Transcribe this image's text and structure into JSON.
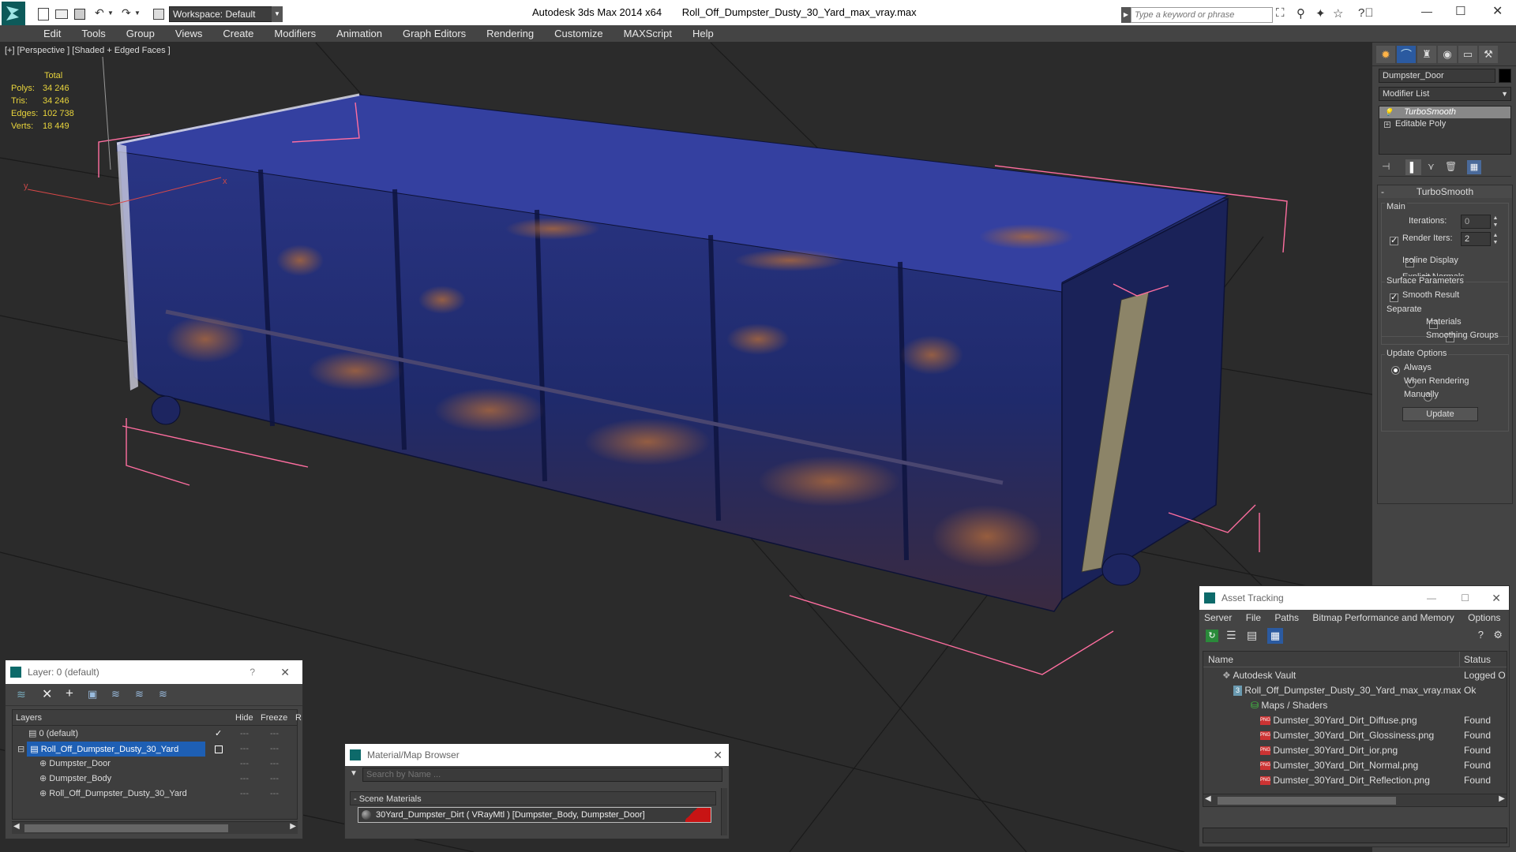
{
  "titlebar": {
    "workspace": "Workspace: Default",
    "app_title": "Autodesk 3ds Max  2014 x64",
    "file_name": "Roll_Off_Dumpster_Dusty_30_Yard_max_vray.max",
    "search_placeholder": "Type a keyword or phrase"
  },
  "menu": [
    "Edit",
    "Tools",
    "Group",
    "Views",
    "Create",
    "Modifiers",
    "Animation",
    "Graph Editors",
    "Rendering",
    "Customize",
    "MAXScript",
    "Help"
  ],
  "viewport": {
    "label": "[+] [Perspective ] [Shaded + Edged Faces ]",
    "stats": {
      "header": "Total",
      "rows": [
        {
          "label": "Polys:",
          "value": "34 246"
        },
        {
          "label": "Tris:",
          "value": "34 246"
        },
        {
          "label": "Edges:",
          "value": "102 738"
        },
        {
          "label": "Verts:",
          "value": "18 449"
        }
      ]
    },
    "axis_y": "y",
    "axis_x": "x"
  },
  "cmdpanel": {
    "object_name": "Dumpster_Door",
    "modifier_list": "Modifier List",
    "stack": [
      "TurboSmooth",
      "Editable Poly"
    ],
    "rollout_title": "TurboSmooth",
    "main_label": "Main",
    "iterations_label": "Iterations:",
    "iterations_value": "0",
    "render_iters_label": "Render Iters:",
    "render_iters_value": "2",
    "isoline": "Isoline Display",
    "explicit": "Explicit Normals",
    "surface_params": "Surface Parameters",
    "smooth_result": "Smooth Result",
    "separate": "Separate",
    "materials": "Materials",
    "smoothing_groups": "Smoothing Groups",
    "update_options": "Update Options",
    "always": "Always",
    "when_rendering": "When Rendering",
    "manually": "Manually",
    "update_button": "Update"
  },
  "layer_window": {
    "title": "Layer: 0 (default)",
    "help": "?",
    "close": "✕",
    "col_layers": "Layers",
    "col_hide": "Hide",
    "col_freeze": "Freeze",
    "col_r": "R",
    "rows": [
      {
        "name": "0 (default)"
      },
      {
        "name": "Roll_Off_Dumpster_Dusty_30_Yard"
      },
      {
        "name": "Dumpster_Door"
      },
      {
        "name": "Dumpster_Body"
      },
      {
        "name": "Roll_Off_Dumpster_Dusty_30_Yard"
      }
    ]
  },
  "material_browser": {
    "title": "Material/Map Browser",
    "search_placeholder": "Search by Name ...",
    "section": "- Scene Materials",
    "item": "30Yard_Dumpster_Dirt  ( VRayMtl ) [Dumpster_Body, Dumpster_Door]"
  },
  "asset_tracking": {
    "title": "Asset Tracking",
    "menu": [
      "Server",
      "File",
      "Paths",
      "Bitmap Performance and Memory",
      "Options"
    ],
    "col_name": "Name",
    "col_status": "Status",
    "rows": [
      {
        "name": "Autodesk Vault",
        "status": "Logged O"
      },
      {
        "name": "Roll_Off_Dumpster_Dusty_30_Yard_max_vray.max",
        "status": "Ok"
      },
      {
        "name": "Maps / Shaders",
        "status": ""
      },
      {
        "name": "Dumster_30Yard_Dirt_Diffuse.png",
        "status": "Found"
      },
      {
        "name": "Dumster_30Yard_Dirt_Glossiness.png",
        "status": "Found"
      },
      {
        "name": "Dumster_30Yard_Dirt_ior.png",
        "status": "Found"
      },
      {
        "name": "Dumster_30Yard_Dirt_Normal.png",
        "status": "Found"
      },
      {
        "name": "Dumster_30Yard_Dirt_Reflection.png",
        "status": "Found"
      }
    ]
  },
  "colors": {
    "accent_blue": "#1e5fb4",
    "stats_yellow": "#e8d43c",
    "dumpster_blue": "#1f2a6b",
    "rust": "#8a4a2a",
    "bbox_pink": "#ff6ea0"
  }
}
